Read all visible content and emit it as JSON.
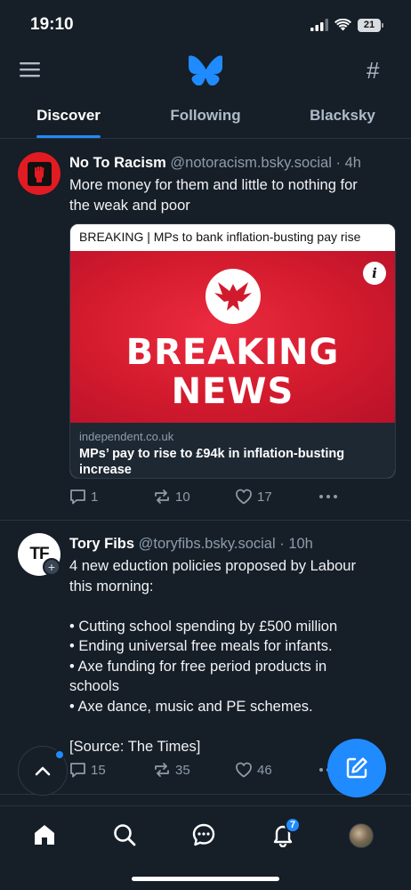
{
  "status_bar": {
    "time": "19:10",
    "battery": "21"
  },
  "tabs": [
    {
      "label": "Discover",
      "active": true
    },
    {
      "label": "Following",
      "active": false
    },
    {
      "label": "Blacksky",
      "active": false
    }
  ],
  "posts": [
    {
      "author": "No To Racism",
      "handle": "@notoracism.bsky.social",
      "time": "· 4h",
      "text_lines": [
        "More money for them and little to nothing for",
        "the weak and poor"
      ],
      "card": {
        "title": "BREAKING | MPs to bank inflation-busting pay rise",
        "image_text": [
          "BREAKING",
          "NEWS"
        ],
        "domain": "independent.co.uk",
        "headline": "MPs’ pay to rise to £94k in inflation-busting increase"
      },
      "replies": "1",
      "reposts": "10",
      "likes": "17"
    },
    {
      "author": "Tory Fibs",
      "handle": "@toryfibs.bsky.social",
      "time": "· 10h",
      "avatar_text": "TF",
      "text_lines": [
        "4 new eduction policies proposed by Labour",
        "this morning:",
        "",
        " • Cutting school spending by £500 million",
        "• Ending universal free meals for infants.",
        "• Axe funding for free period products in",
        "schools",
        "• Axe dance, music and PE schemes.",
        "",
        "[Source: The Times]"
      ],
      "replies": "15",
      "reposts": "35",
      "likes": "46"
    }
  ],
  "notifications_count": "7",
  "colors": {
    "accent": "#208bfe",
    "background": "#161e27",
    "muted": "#8d9cab"
  }
}
